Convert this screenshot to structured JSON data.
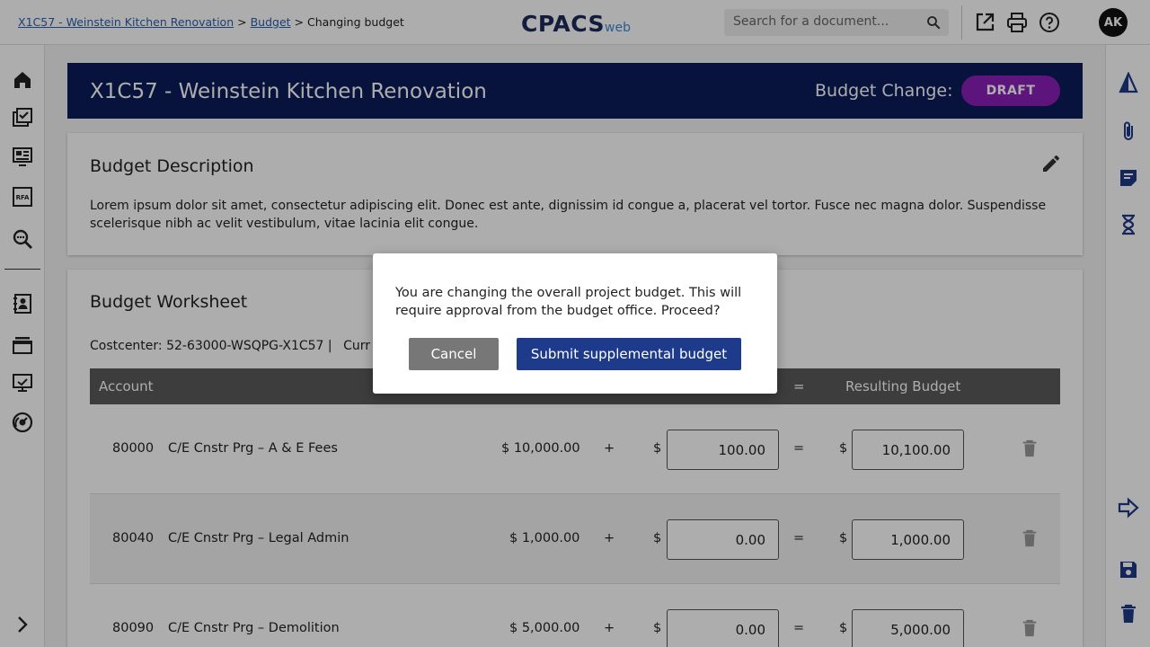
{
  "breadcrumb": {
    "project_link": "X1C57 - Weinstein Kitchen Renovation",
    "sep1": ">",
    "budget_link": "Budget",
    "sep2": ">",
    "current": "Changing budget"
  },
  "logo": {
    "main": "CPACS",
    "sub": "web"
  },
  "search": {
    "placeholder": "Search for a document..."
  },
  "user": {
    "initials": "AK"
  },
  "header": {
    "title": "X1C57 - Weinstein Kitchen Renovation",
    "change_label": "Budget Change:",
    "status": "DRAFT",
    "status_color": "#8a1fb8"
  },
  "description": {
    "heading": "Budget Description",
    "text": "Lorem ipsum dolor sit amet, consectetur adipiscing elit. Donec est ante, dignissim id congue a, placerat vel tortor. Fusce nec magna dolor. Suspendisse scelerisque nibh ac velit vestibulum, vitae lacinia elit congue."
  },
  "worksheet": {
    "heading": "Budget Worksheet",
    "costcenter": "Costcenter: 52-63000-WSQPG-X1C57 |",
    "costcenter_extra": "Curr",
    "columns": {
      "account": "Account",
      "equals": "=",
      "resulting": "Resulting Budget"
    },
    "rows": [
      {
        "code": "80000",
        "name": "C/E Cnstr Prg – A & E Fees",
        "current": "$ 10,000.00",
        "plus": "+",
        "dollar1": "$",
        "change": "100.00",
        "eq": "=",
        "dollar2": "$",
        "result": "10,100.00"
      },
      {
        "code": "80040",
        "name": "C/E Cnstr Prg – Legal Admin",
        "current": "$ 1,000.00",
        "plus": "+",
        "dollar1": "$",
        "change": "0.00",
        "eq": "=",
        "dollar2": "$",
        "result": "1,000.00"
      },
      {
        "code": "80090",
        "name": "C/E Cnstr Prg – Demolition",
        "current": "$ 5,000.00",
        "plus": "+",
        "dollar1": "$",
        "change": "0.00",
        "eq": "=",
        "dollar2": "$",
        "result": "5,000.00"
      }
    ]
  },
  "dialog": {
    "message": "You are changing the overall project budget. This will require approval from the budget office. Proceed?",
    "cancel_label": "Cancel",
    "submit_label": "Submit supplemental budget"
  },
  "icons": {
    "top": [
      "search-icon",
      "open-external-icon",
      "print-icon",
      "help-icon"
    ],
    "left": [
      "home-icon",
      "task-check-icon",
      "presentation-icon",
      "rfa-icon",
      "zoom-search-icon",
      "contacts-icon",
      "printer-tray-icon",
      "monitor-icon",
      "dashboard-gauge-icon",
      "expand-chevron-icon"
    ],
    "right": [
      "delta-icon",
      "attachment-icon",
      "notes-icon",
      "hourglass-icon",
      "arrow-forward-icon",
      "save-icon",
      "delete-icon"
    ]
  },
  "colors": {
    "navy": "#0b1c5a",
    "submit": "#1e3a8a",
    "badge": "#8a1fb8"
  }
}
